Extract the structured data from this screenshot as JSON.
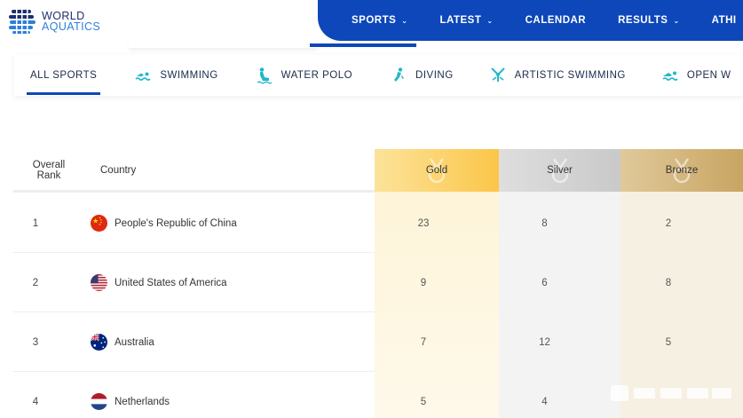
{
  "header": {
    "logo": {
      "line1": "WORLD",
      "line2": "AQUATICS"
    },
    "nav": [
      {
        "label": "SPORTS",
        "has_dropdown": true
      },
      {
        "label": "LATEST",
        "has_dropdown": true
      },
      {
        "label": "CALENDAR",
        "has_dropdown": false
      },
      {
        "label": "RESULTS",
        "has_dropdown": true
      },
      {
        "label": "ATHI",
        "has_dropdown": false
      }
    ],
    "chevron": "⌄",
    "colors": {
      "nav_bg": "#0d47b9",
      "logo_dark": "#1c2f6e",
      "logo_light": "#2f7fd8"
    }
  },
  "tabs": [
    {
      "label": "ALL SPORTS",
      "icon": null,
      "active": true
    },
    {
      "label": "SWIMMING",
      "icon": "swimming-icon",
      "active": false
    },
    {
      "label": "WATER POLO",
      "icon": "water-polo-icon",
      "active": false
    },
    {
      "label": "DIVING",
      "icon": "diving-icon",
      "active": false
    },
    {
      "label": "ARTISTIC SWIMMING",
      "icon": "artistic-swimming-icon",
      "active": false
    },
    {
      "label": "OPEN W",
      "icon": "open-water-icon",
      "active": false
    }
  ],
  "table": {
    "headers": {
      "rank_line1": "Overall",
      "rank_line2": "Rank",
      "country": "Country",
      "gold": "Gold",
      "silver": "Silver",
      "bronze": "Bronze"
    },
    "rows": [
      {
        "rank": "1",
        "country": "People's Republic of China",
        "flag": "china-flag-icon",
        "gold": "23",
        "silver": "8",
        "bronze": "2"
      },
      {
        "rank": "2",
        "country": "United States of America",
        "flag": "usa-flag-icon",
        "gold": "9",
        "silver": "6",
        "bronze": "8"
      },
      {
        "rank": "3",
        "country": "Australia",
        "flag": "australia-flag-icon",
        "gold": "7",
        "silver": "12",
        "bronze": "5"
      },
      {
        "rank": "4",
        "country": "Netherlands",
        "flag": "netherlands-flag-icon",
        "gold": "5",
        "silver": "4",
        "bronze": ""
      }
    ]
  }
}
